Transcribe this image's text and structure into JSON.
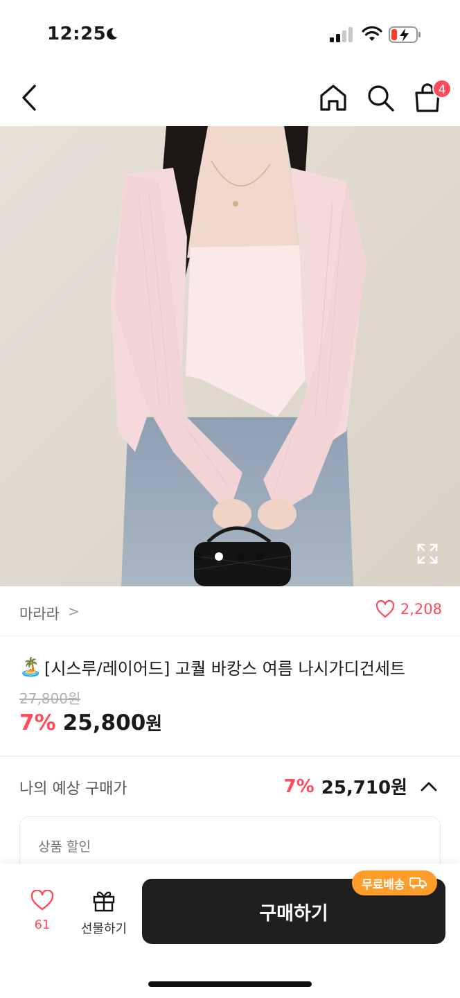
{
  "status_bar": {
    "time": "12:25",
    "icons": [
      "moon-icon",
      "signal-icon",
      "wifi-icon",
      "battery-charging-icon"
    ]
  },
  "top_nav": {
    "icons": [
      "back-icon",
      "home-icon",
      "search-icon",
      "cart-icon"
    ],
    "cart_badge": "4"
  },
  "gallery": {
    "image_count": 4,
    "active_index": 1
  },
  "store": {
    "name": "마라라",
    "chevron": ">",
    "like_count": "2,208"
  },
  "product": {
    "emoji": "🏝️",
    "title": "[시스루/레이어드] 고퀄 바캉스 여름 나시가디건세트",
    "original_price": "27,800원",
    "discount": "7%",
    "price": "25,800",
    "currency": "원"
  },
  "expected_price": {
    "label": "나의 예상 구매가",
    "discount": "7%",
    "price": "25,710원"
  },
  "discount_card": {
    "label": "상품 할인"
  },
  "bottom_bar": {
    "wish_count": "61",
    "gift_label": "선물하기",
    "buy_label": "구매하기",
    "free_shipping_label": "무료배송"
  },
  "colors": {
    "accent": "#ff4b5c",
    "badge_orange": "#ff9c2a",
    "buy_button": "#1f1f1f"
  }
}
